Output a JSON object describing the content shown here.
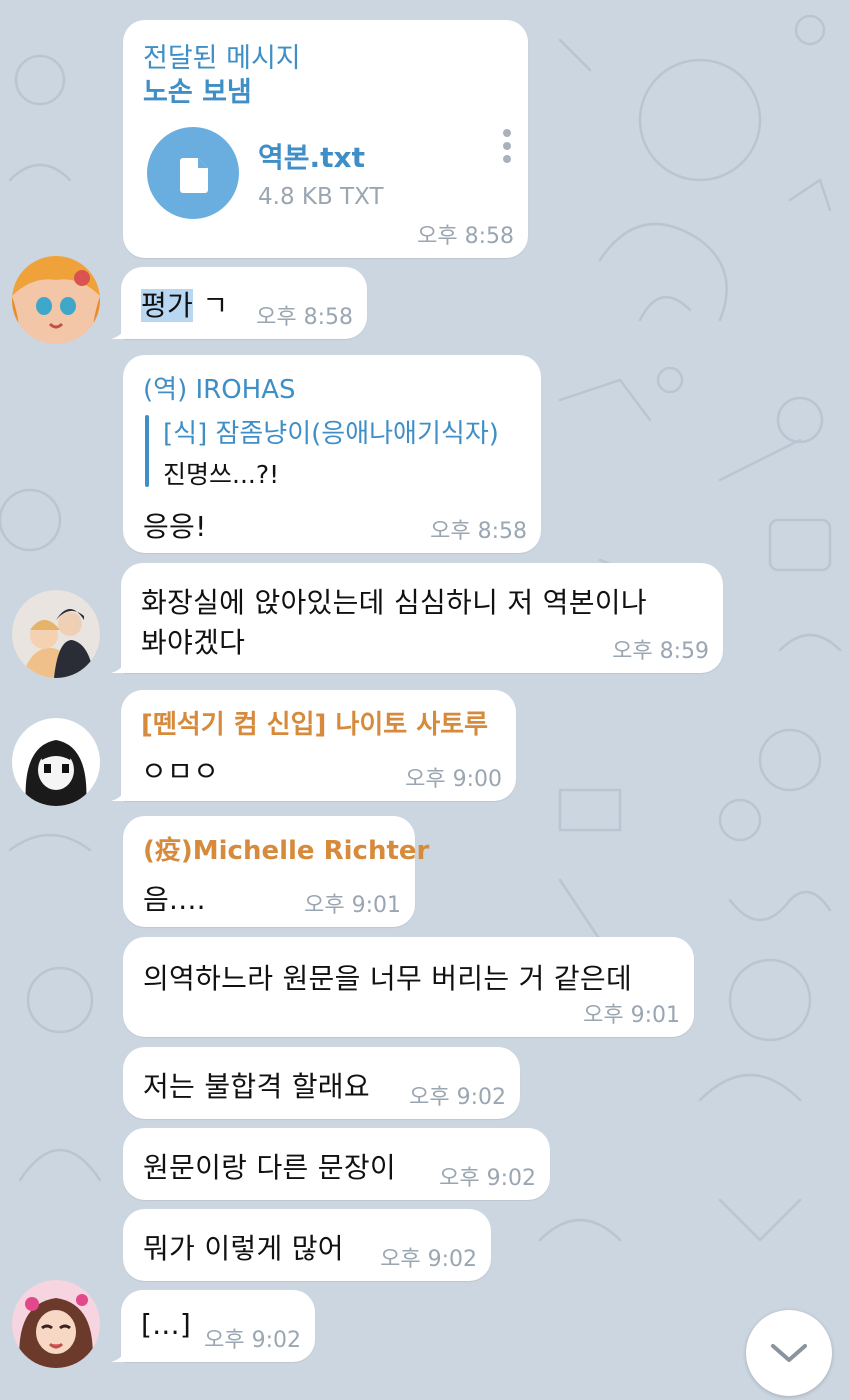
{
  "colors": {
    "background": "#ccd6e1",
    "bubble": "#ffffff",
    "link_blue": "#3f8fc6",
    "sender_orange": "#d68a3c",
    "time_gray": "#9aa6b2",
    "file_icon_bg": "#6aaee0"
  },
  "messages": {
    "m1": {
      "forward_label": "전달된 메시지",
      "forward_from": "노손 보냄",
      "file_name": "역본.txt",
      "file_meta": "4.8 KB TXT",
      "time": "오후 8:58"
    },
    "m2": {
      "text_highlight": "평가",
      "text_rest": " ㄱ",
      "time": "오후 8:58"
    },
    "m3": {
      "sender": "(역) IROHAS",
      "reply_name": "[식] 잠좀냥이(응애나애기식자)",
      "reply_text": "진명쓰...?!",
      "text": "응응!",
      "time": "오후 8:58"
    },
    "m4": {
      "line1": "화장실에 앉아있는데 심심하니 저 역본이나",
      "line2": "봐야겠다",
      "time": "오후 8:59"
    },
    "m5": {
      "sender": "[뗀석기 컴 신입] 나이토 사토루",
      "text": "ㅇㅁㅇ",
      "time": "오후 9:00"
    },
    "m6": {
      "sender": "(疫)Michelle Richter",
      "text": "음....",
      "time": "오후 9:01"
    },
    "m7": {
      "text": "의역하느라 원문을 너무 버리는 거 같은데",
      "time": "오후 9:01"
    },
    "m8": {
      "text": "저는 불합격 할래요",
      "time": "오후 9:02"
    },
    "m9": {
      "text": "원문이랑 다른 문장이",
      "time": "오후 9:02"
    },
    "m10": {
      "text": "뭐가 이렇게 많어",
      "time": "오후 9:02"
    },
    "m11": {
      "text": "[...]",
      "time": "오후 9:02"
    }
  },
  "icons": {
    "file": "document-icon",
    "menu": "more-vertical-icon",
    "scroll": "chevron-down-icon"
  }
}
